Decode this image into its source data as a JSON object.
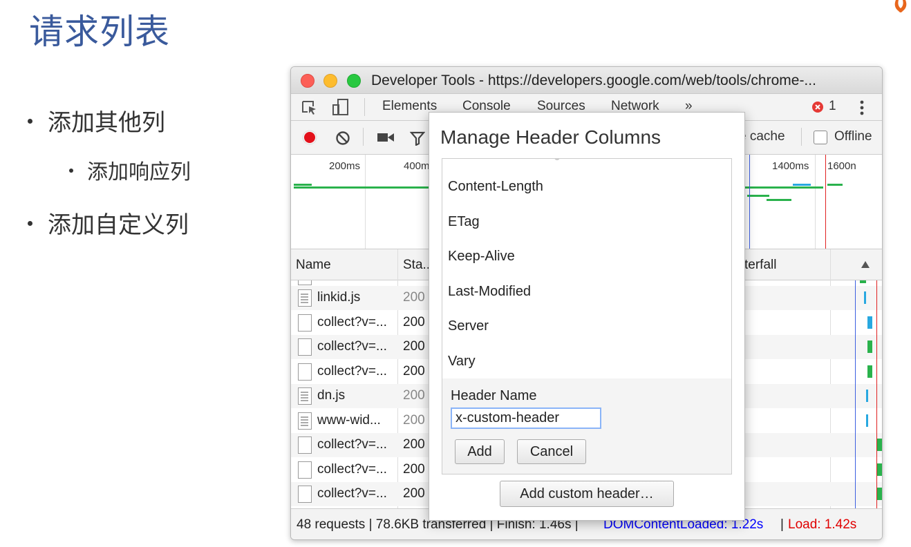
{
  "slide": {
    "title": "请求列表",
    "bullets": [
      "添加其他列",
      "添加响应列",
      "添加自定义列"
    ]
  },
  "window": {
    "title": "Developer Tools - https://developers.google.com/web/tools/chrome-..."
  },
  "devtools": {
    "tabs": [
      "Elements",
      "Console",
      "Sources",
      "Network",
      "»"
    ],
    "error_count": "1",
    "toolbar": {
      "disable_cache_fragment": "e cache",
      "offline_label": "Offline"
    },
    "timeline_ticks": [
      "200ms",
      "400m",
      "1400ms",
      "1600n"
    ],
    "columns": {
      "name": "Name",
      "status": "Sta...",
      "waterfall": "terfall"
    },
    "rows": [
      {
        "name": "linkid.js",
        "status": "200",
        "icon": "script-file-icon",
        "status_muted": true
      },
      {
        "name": "collect?v=...",
        "status": "200",
        "icon": "blank-file-icon",
        "status_muted": false
      },
      {
        "name": "collect?v=...",
        "status": "200",
        "icon": "blank-file-icon",
        "status_muted": false
      },
      {
        "name": "collect?v=...",
        "status": "200",
        "icon": "blank-file-icon",
        "status_muted": false
      },
      {
        "name": "dn.js",
        "status": "200",
        "icon": "script-file-icon",
        "status_muted": true
      },
      {
        "name": "www-wid...",
        "status": "200",
        "icon": "script-file-icon",
        "status_muted": true
      },
      {
        "name": "collect?v=...",
        "status": "200",
        "icon": "blank-file-icon",
        "status_muted": false
      },
      {
        "name": "collect?v=...",
        "status": "200",
        "icon": "blank-file-icon",
        "status_muted": false
      },
      {
        "name": "collect?v=...",
        "status": "200",
        "icon": "blank-file-icon",
        "status_muted": false
      }
    ],
    "status_bar": {
      "summary": "48 requests | 78.6KB transferred | Finish: 1.46s |",
      "dom_content_loaded": "DOMContentLoaded: 1.22s",
      "separator": "|",
      "load": "Load: 1.42s",
      "dom_color": "#0000ff",
      "load_color": "#e00000"
    }
  },
  "dialog": {
    "title": "Manage Header Columns",
    "headers": [
      "Content-Length",
      "ETag",
      "Keep-Alive",
      "Last-Modified",
      "Server",
      "Vary"
    ],
    "form": {
      "label": "Header Name",
      "value": "x-custom-header",
      "add_label": "Add",
      "cancel_label": "Cancel"
    },
    "add_custom_label": "Add custom header…"
  }
}
